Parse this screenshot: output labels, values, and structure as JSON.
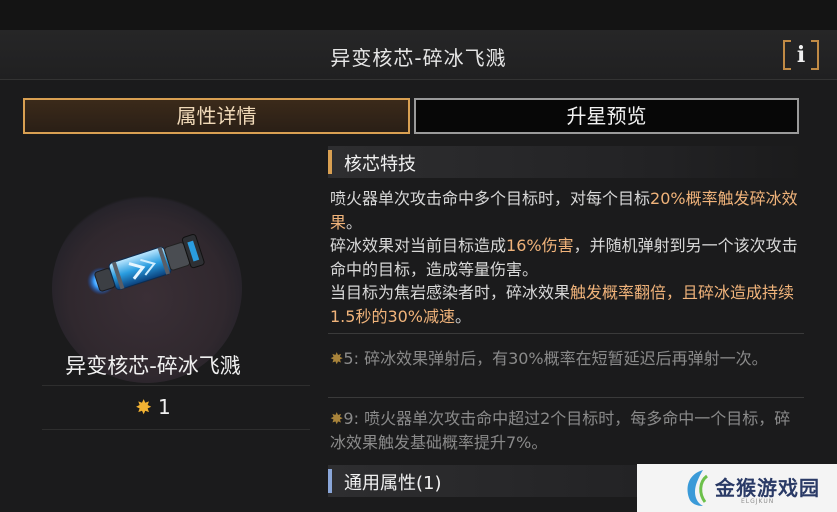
{
  "header": {
    "title": "异变核芯-碎冰飞溅",
    "info_glyph": "i"
  },
  "tabs": [
    {
      "label": "属性详情",
      "active": true
    },
    {
      "label": "升星预览",
      "active": false
    }
  ],
  "item": {
    "name": "异变核芯-碎冰飞溅",
    "stars": "1",
    "star_color": "#f2b233"
  },
  "sections": {
    "core": {
      "title": "核芯特技",
      "bar_color": "#d9a052"
    },
    "general": {
      "title": "通用属性(1)",
      "bar_color": "#8aa6d8"
    }
  },
  "description": {
    "p1_a": "喷火器单次攻击命中多个目标时，对每个目标",
    "p1_hl": "20%概率触发碎冰效果",
    "p1_b": "。",
    "p2_a": "碎冰效果对当前目标造成",
    "p2_hl": "16%伤害",
    "p2_b": "，并随机弹射到另一个该次攻击命中的目标，造成等量伤害。",
    "p3_a": "当目标为焦岩感染者时，碎冰效果",
    "p3_hl": "触发概率翻倍，且碎冰造成持续1.5秒的30%减速",
    "p3_b": "。"
  },
  "upgrades": [
    {
      "level": "5",
      "text": ": 碎冰效果弹射后，有30%概率在短暂延迟后再弹射一次。"
    },
    {
      "level": "9",
      "text": ": 喷火器单次攻击命中超过2个目标时，每多命中一个目标，碎冰效果触发基础概率提升7%。"
    }
  ],
  "watermark": {
    "text": "金猴游戏园",
    "sub": "ELGJKUN"
  },
  "colors": {
    "accent": "#d9a052",
    "highlight": "#f0b37a",
    "background": "#1b1b1c"
  }
}
